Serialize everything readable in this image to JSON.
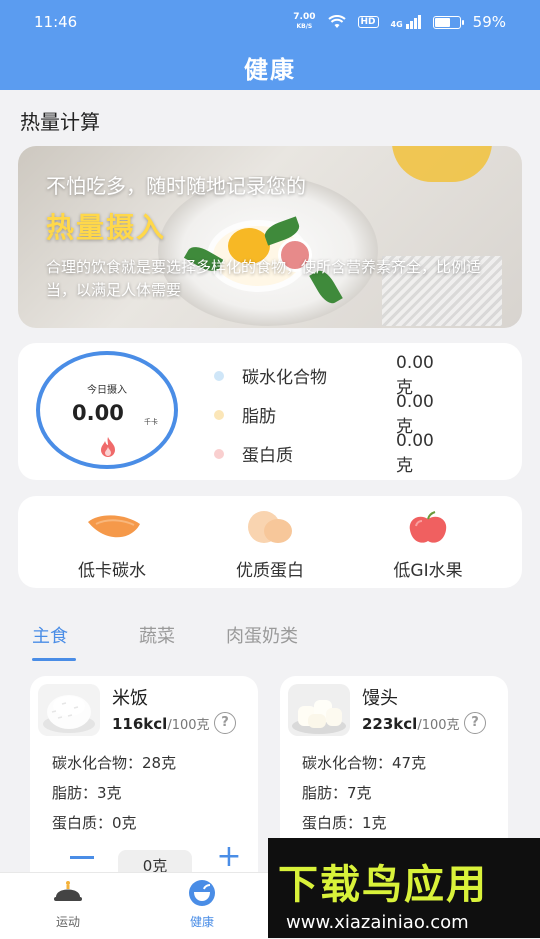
{
  "status_bar": {
    "time": "11:46",
    "net_speed": "7.00",
    "net_unit": "KB/S",
    "hd": "HD",
    "signal": "4G",
    "battery_level": 0.59,
    "battery": "59%"
  },
  "header": {
    "title": "健康"
  },
  "section_title": "热量计算",
  "banner": {
    "line1": "不怕吃多，随时随地记录您的",
    "line2": "热量摄入",
    "desc": "合理的饮食就是要选择多样化的食物，使所含营养素齐全，比例适当，以满足人体需要"
  },
  "intake": {
    "label": "今日摄入",
    "value": "0.00",
    "unit": "千卡",
    "nutrients": [
      {
        "name": "碳水化合物",
        "value": "0.00克",
        "color": "#cfe6f8"
      },
      {
        "name": "脂肪",
        "value": "0.00克",
        "color": "#fbe6b8"
      },
      {
        "name": "蛋白质",
        "value": "0.00克",
        "color": "#f9cfcf"
      }
    ]
  },
  "categories": [
    {
      "label": "低卡碳水",
      "icon": "sweet-potato-icon"
    },
    {
      "label": "优质蛋白",
      "icon": "egg-icon"
    },
    {
      "label": "低GI水果",
      "icon": "apple-icon"
    }
  ],
  "tabs": [
    {
      "label": "主食",
      "active": true
    },
    {
      "label": "蔬菜",
      "active": false
    },
    {
      "label": "肉蛋奶类",
      "active": false
    }
  ],
  "foods": [
    {
      "name": "米饭",
      "kcal": "116kcl",
      "per": "/100克",
      "carbs": "碳水化合物：28克",
      "fat": "脂肪：3克",
      "protein": "蛋白质：0克",
      "qty": "0克"
    },
    {
      "name": "馒头",
      "kcal": "223kcl",
      "per": "/100克",
      "carbs": "碳水化合物：47克",
      "fat": "脂肪：7克",
      "protein": "蛋白质：1克"
    }
  ],
  "bottom_nav": [
    {
      "label": "运动",
      "active": false
    },
    {
      "label": "健康",
      "active": true
    }
  ],
  "watermark": {
    "title": "下载鸟应用",
    "url": "www.xiazainiao.com"
  },
  "colors": {
    "primary": "#5b9cf0",
    "accent": "#4a8de6",
    "highlight": "#ffd84a"
  }
}
